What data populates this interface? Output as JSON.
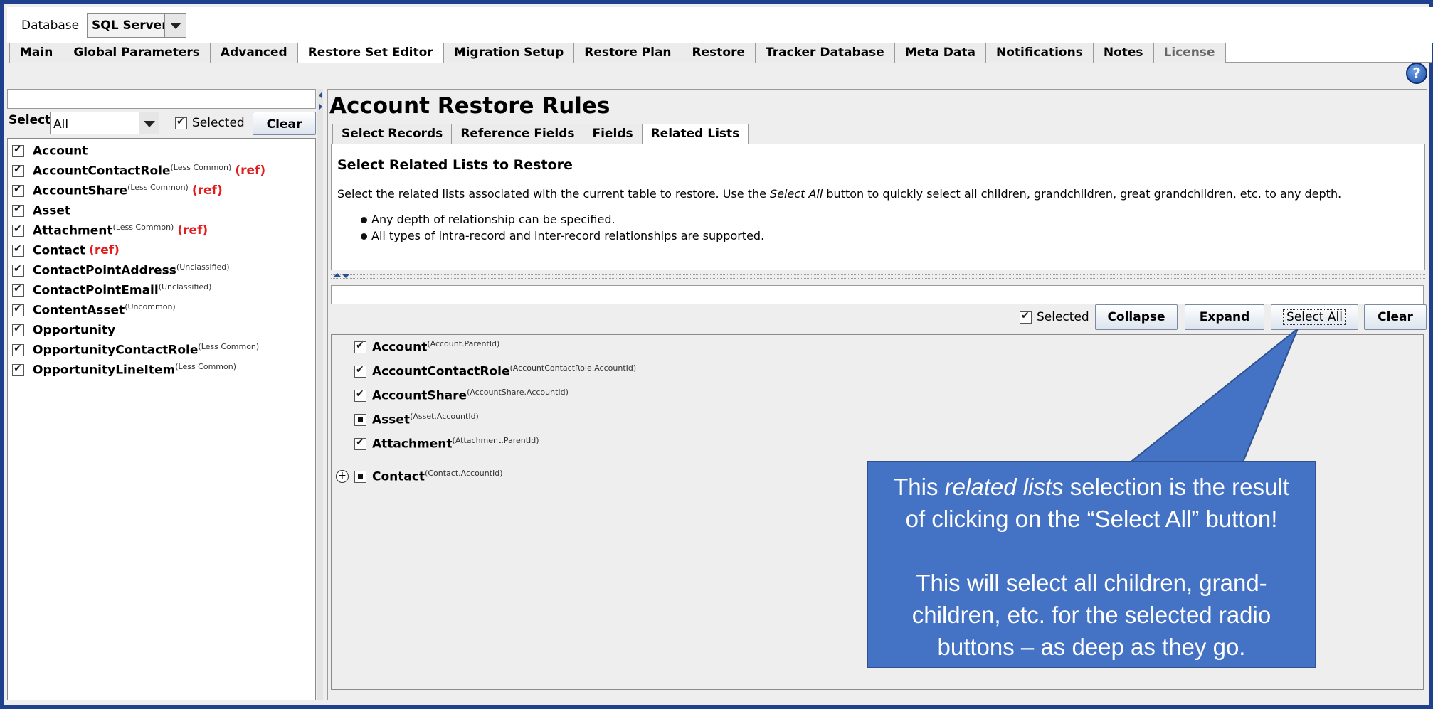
{
  "database": {
    "label": "Database",
    "value": "SQL Server"
  },
  "main_tabs": [
    "Main",
    "Global Parameters",
    "Advanced",
    "Restore Set Editor",
    "Migration Setup",
    "Restore Plan",
    "Restore",
    "Tracker Database",
    "Meta Data",
    "Notifications",
    "Notes",
    "License"
  ],
  "active_main_tab": "Restore Set Editor",
  "help_glyph": "?",
  "left": {
    "search_value": "",
    "select_label": "Select:",
    "select_value": "All",
    "selected_label": "Selected",
    "clear_label": "Clear",
    "items": [
      {
        "name": "Account",
        "sup": "",
        "ref": ""
      },
      {
        "name": "AccountContactRole",
        "sup": "(Less Common)",
        "ref": "(ref)"
      },
      {
        "name": "AccountShare",
        "sup": "(Less Common)",
        "ref": "(ref)"
      },
      {
        "name": "Asset",
        "sup": "",
        "ref": ""
      },
      {
        "name": "Attachment",
        "sup": "(Less Common)",
        "ref": "(ref)"
      },
      {
        "name": "Contact",
        "sup": "",
        "ref": "(ref)"
      },
      {
        "name": "ContactPointAddress",
        "sup": "(Unclassified)",
        "ref": ""
      },
      {
        "name": "ContactPointEmail",
        "sup": "(Unclassified)",
        "ref": ""
      },
      {
        "name": "ContentAsset",
        "sup": "(Uncommon)",
        "ref": ""
      },
      {
        "name": "Opportunity",
        "sup": "",
        "ref": ""
      },
      {
        "name": "OpportunityContactRole",
        "sup": "(Less Common)",
        "ref": ""
      },
      {
        "name": "OpportunityLineItem",
        "sup": "(Less Common)",
        "ref": ""
      }
    ]
  },
  "right": {
    "title": "Account Restore Rules",
    "sub_tabs": [
      "Select Records",
      "Reference Fields",
      "Fields",
      "Related Lists"
    ],
    "active_sub_tab": "Related Lists",
    "desc_title": "Select Related Lists to Restore",
    "desc_text_1": "Select the related lists associated with the current table to restore. Use the ",
    "desc_text_em": "Select All",
    "desc_text_2": " button to quickly select all children, grandchildren, great grandchildren, etc. to any depth.",
    "bullets": [
      "Any depth of relationship can be specified.",
      "All types of intra-record and inter-record relationships are supported."
    ],
    "selected_label": "Selected",
    "collapse_label": "Collapse",
    "expand_label": "Expand",
    "select_all_label": "Select All",
    "clear_label": "Clear",
    "tree": [
      {
        "name": "Account",
        "sup": "(Account.ParentId)",
        "state": "checked"
      },
      {
        "name": "AccountContactRole",
        "sup": "(AccountContactRole.AccountId)",
        "state": "checked"
      },
      {
        "name": "AccountShare",
        "sup": "(AccountShare.AccountId)",
        "state": "checked"
      },
      {
        "name": "Asset",
        "sup": "(Asset.AccountId)",
        "state": "partial"
      },
      {
        "name": "Attachment",
        "sup": "(Attachment.ParentId)",
        "state": "checked"
      },
      {
        "name": "Contact",
        "sup": "(Contact.AccountId)",
        "state": "partial"
      }
    ]
  },
  "callout": {
    "line1_a": "This ",
    "line1_em": "related lists",
    "line1_b": " selection is the result",
    "line2": "of clicking on the  “Select All” button!",
    "line3": "This will select all children, grand-",
    "line4": "children, etc. for the selected radio",
    "line5": "buttons – as deep as they go.",
    "color": "#4472c4"
  }
}
